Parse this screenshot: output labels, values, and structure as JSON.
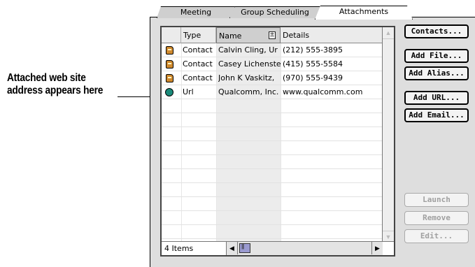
{
  "callout": {
    "text": "Attached web site address appears here"
  },
  "tabs": [
    {
      "label": "Meeting"
    },
    {
      "label": "Group Scheduling"
    },
    {
      "label": "Attachments"
    }
  ],
  "columns": {
    "type": "Type",
    "name": "Name",
    "details": "Details"
  },
  "rows": [
    {
      "icon": "contact-card-icon",
      "type": "Contact",
      "name": "Calvin Cling, Ur",
      "details": "(212) 555-3895"
    },
    {
      "icon": "contact-card-icon",
      "type": "Contact",
      "name": "Casey Lichenste",
      "details": "(415) 555-5584"
    },
    {
      "icon": "contact-card-icon",
      "type": "Contact",
      "name": "John K Vaskitz,",
      "details": "(970) 555-9439"
    },
    {
      "icon": "url-globe-icon",
      "type": "Url",
      "name": "Qualcomm, Inc.",
      "details": "www.qualcomm.com"
    }
  ],
  "footer": {
    "count": "4 Items"
  },
  "buttons": {
    "contacts": "Contacts...",
    "add_file": "Add File...",
    "add_alias": "Add Alias...",
    "add_url": "Add URL...",
    "add_email": "Add Email...",
    "launch": "Launch",
    "remove": "Remove",
    "edit": "Edit..."
  },
  "colors": {
    "contact_icon": "#d08a2e",
    "url_icon": "#1a8a7a",
    "scroll_thumb": "#9a9ad0"
  }
}
